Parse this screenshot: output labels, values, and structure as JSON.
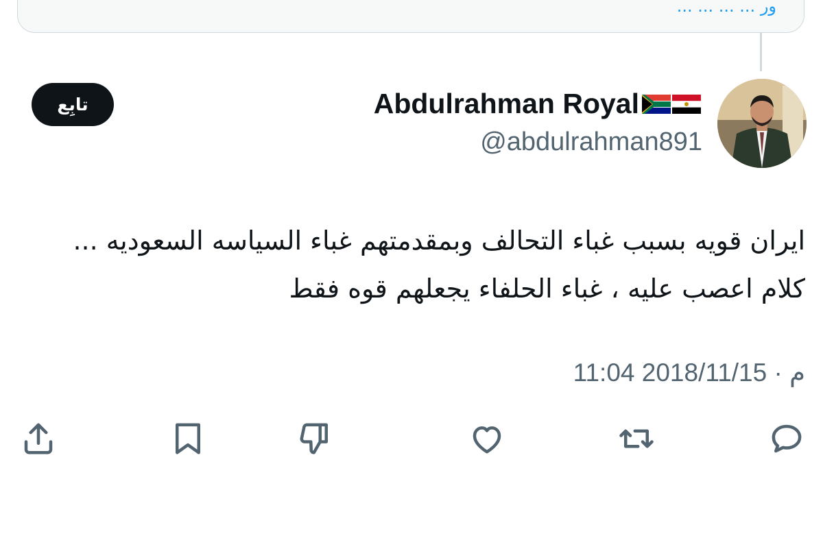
{
  "quote": {
    "text": "ور ... ... ... ..."
  },
  "author": {
    "display_name": "Abdulrahman Royal",
    "handle": "@abdulrahman891",
    "avatar_icon": "avatar-photo",
    "flags": [
      "south-africa-flag",
      "egypt-flag"
    ]
  },
  "follow_button": {
    "label": "تابِع"
  },
  "tweet": {
    "text": "ايران قويه بسبب غباء التحالف وبمقدمتهم غباء السياسه السعوديه ... كلام اعصب عليه ، غباء الحلفاء يجعلهم قوه فقط",
    "timestamp": "11:04 م · 2018/11/15"
  },
  "actions": [
    {
      "icon": "share-icon"
    },
    {
      "icon": "bookmark-icon"
    },
    {
      "icon": "dislike-icon"
    },
    {
      "icon": "like-icon"
    },
    {
      "icon": "retweet-icon"
    },
    {
      "icon": "reply-icon"
    }
  ],
  "colors": {
    "text_primary": "#0f1419",
    "text_secondary": "#536471",
    "accent": "#1d9bf0",
    "follow_bg": "#0f1419",
    "border": "#cfd9de"
  }
}
